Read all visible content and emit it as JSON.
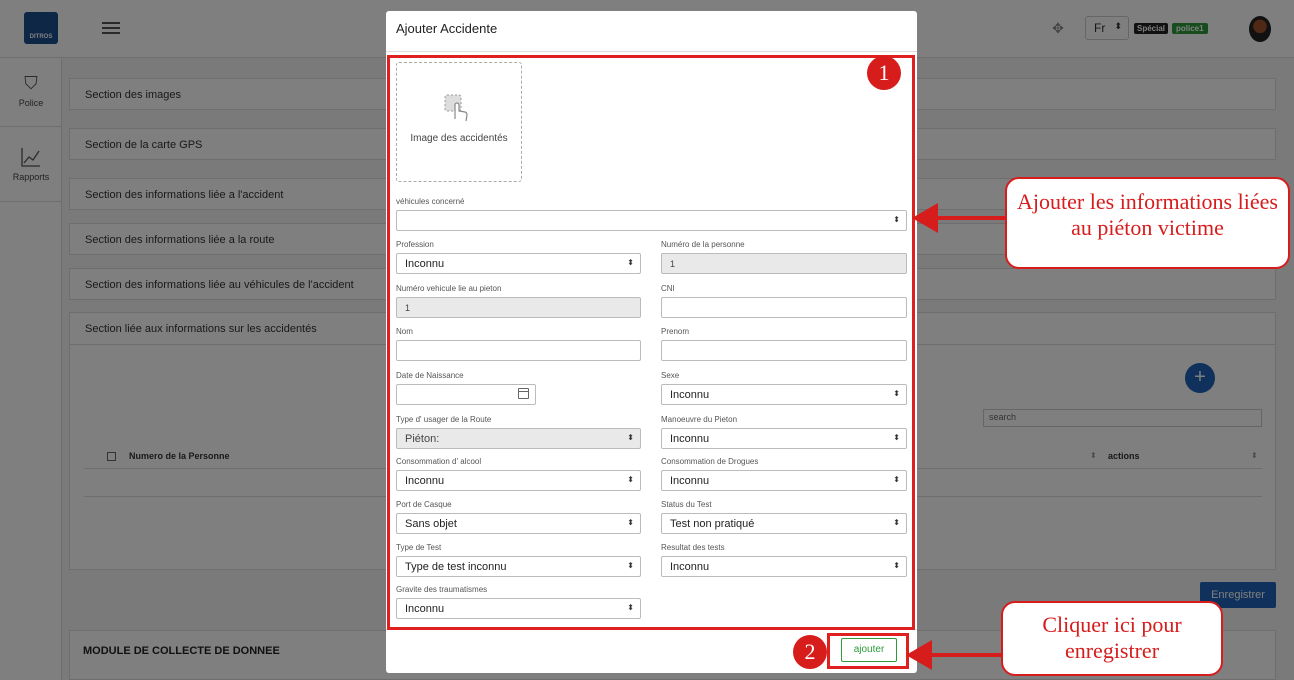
{
  "topbar": {
    "logo_text": "DITROS",
    "language": "Fr",
    "badge_special": "Spécial",
    "badge_user": "police1"
  },
  "sidebar": {
    "items": [
      {
        "label": "Police",
        "icon": "shield-star-icon"
      },
      {
        "label": "Rapports",
        "icon": "line-chart-icon"
      }
    ]
  },
  "sections": [
    "Section des images",
    "Section de la carte GPS",
    "Section des informations liée a l'accident",
    "Section des informations liée a la route",
    "Section des informations liée au véhicules de l'accident"
  ],
  "accident_card": {
    "title": "Section liée aux informations sur les accidentés",
    "search_placeholder": "search",
    "col_numero": "Numero de la Personne",
    "col_actions": "actions"
  },
  "save_button": "Enregistrer",
  "module_title": "MODULE DE COLLECTE DE DONNEE",
  "modal": {
    "title": "Ajouter Accidente",
    "upload_label": "Image des accidentés",
    "fields": {
      "vehicules": {
        "label": "véhicules concerné",
        "value": ""
      },
      "profession": {
        "label": "Profession",
        "value": "Inconnu"
      },
      "numero_personne": {
        "label": "Numéro de la personne",
        "value": "1"
      },
      "numero_vehicule": {
        "label": "Numéro vehicule lie au pieton",
        "value": "1"
      },
      "cni": {
        "label": "CNI",
        "value": ""
      },
      "nom": {
        "label": "Nom",
        "value": ""
      },
      "prenom": {
        "label": "Prenom",
        "value": ""
      },
      "date_naissance": {
        "label": "Date de Naissance",
        "value": ""
      },
      "sexe": {
        "label": "Sexe",
        "value": "Inconnu"
      },
      "type_usager": {
        "label": "Type d' usager de la Route",
        "value": "Piéton:"
      },
      "manoeuvre": {
        "label": "Manoeuvre du Pieton",
        "value": "Inconnu"
      },
      "alcool": {
        "label": "Consommation d' alcool",
        "value": "Inconnu"
      },
      "drogues": {
        "label": "Consommation de Drogues",
        "value": "Inconnu"
      },
      "casque": {
        "label": "Port de Casque",
        "value": "Sans objet"
      },
      "status_test": {
        "label": "Status du Test",
        "value": "Test non pratiqué"
      },
      "type_test": {
        "label": "Type de Test",
        "value": "Type de test inconnu"
      },
      "resultat": {
        "label": "Resultat des tests",
        "value": "Inconnu"
      },
      "gravite": {
        "label": "Gravite des traumatismes",
        "value": "Inconnu"
      }
    },
    "submit_label": "ajouter"
  },
  "annotations": {
    "step1": "1",
    "step2": "2",
    "callout_info": "Ajouter les informations liées au piéton victime",
    "callout_save": "Cliquer ici pour enregistrer",
    "color": "#d71c1c"
  }
}
